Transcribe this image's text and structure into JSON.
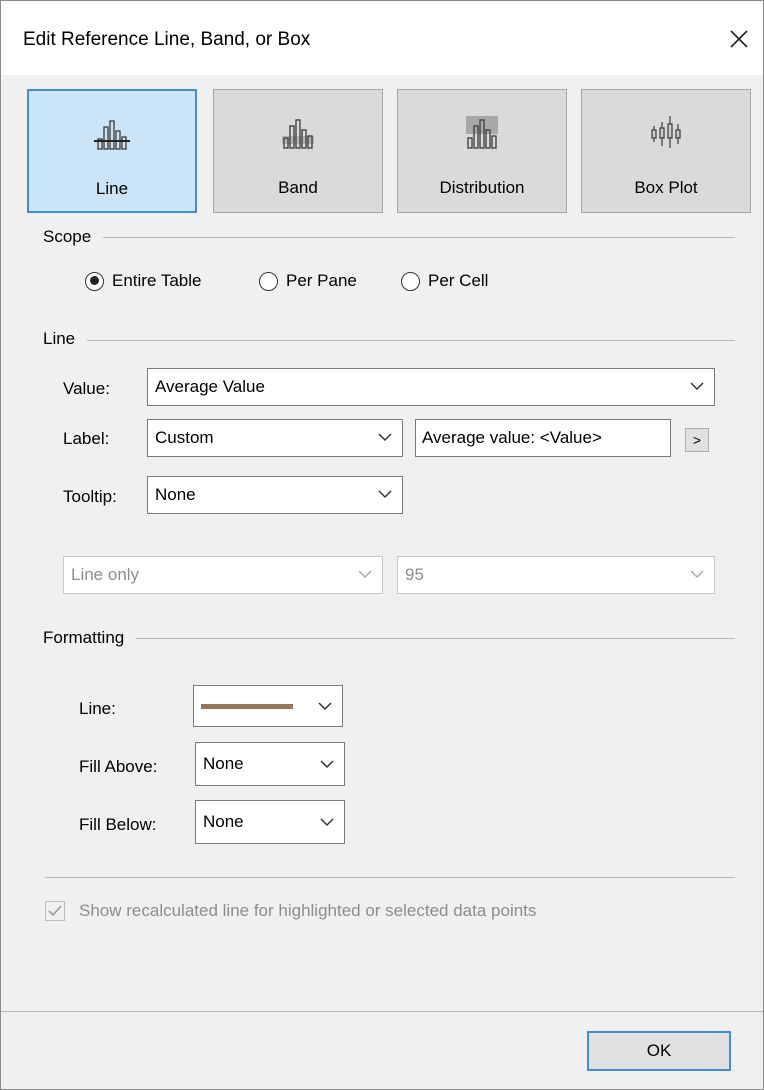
{
  "dialog": {
    "title": "Edit Reference Line, Band, or Box"
  },
  "type_buttons": [
    {
      "label": "Line",
      "icon": "reference-line-icon",
      "selected": true
    },
    {
      "label": "Band",
      "icon": "reference-band-icon",
      "selected": false
    },
    {
      "label": "Distribution",
      "icon": "distribution-icon",
      "selected": false
    },
    {
      "label": "Box Plot",
      "icon": "box-plot-icon",
      "selected": false
    }
  ],
  "scope": {
    "title": "Scope",
    "options": [
      {
        "label": "Entire Table",
        "checked": true
      },
      {
        "label": "Per Pane",
        "checked": false
      },
      {
        "label": "Per Cell",
        "checked": false
      }
    ]
  },
  "line": {
    "title": "Line",
    "value_label": "Value:",
    "value_selected": "Average Value",
    "label_label": "Label:",
    "label_selected": "Custom",
    "label_text": "Average value: <Value>",
    "insert_button": ">",
    "tooltip_label": "Tooltip:",
    "tooltip_selected": "None",
    "confidence_selected": "Line only",
    "confidence_value": "95"
  },
  "formatting": {
    "title": "Formatting",
    "line_label": "Line:",
    "line_color": "#9a7458",
    "fill_above_label": "Fill Above:",
    "fill_above_selected": "None",
    "fill_below_label": "Fill Below:",
    "fill_below_selected": "None"
  },
  "recalc": {
    "label": "Show recalculated line for highlighted or selected data points",
    "checked": true,
    "enabled": false
  },
  "ok_label": "OK"
}
